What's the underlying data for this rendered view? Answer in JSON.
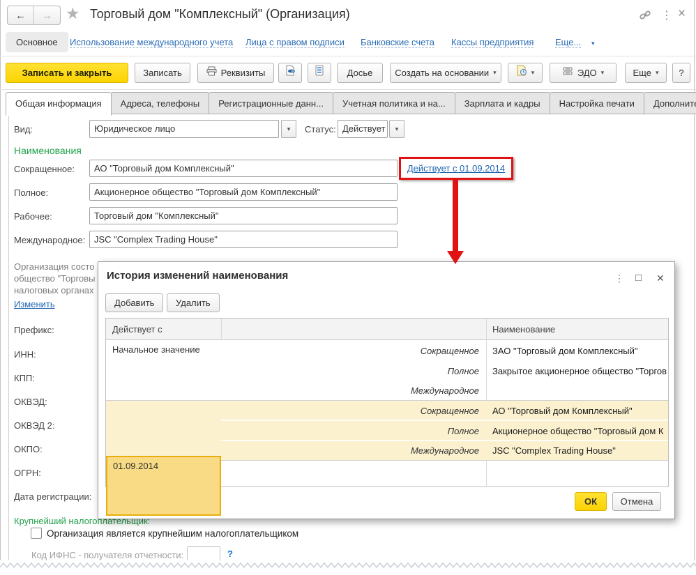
{
  "header": {
    "title": "Торговый дом \"Комплексный\" (Организация)",
    "nav": {
      "active_label": "Основное",
      "links": [
        "Использование международного учета",
        "Лица с правом подписи",
        "Банковские счета",
        "Кассы предприятия"
      ],
      "more_label": "Еще..."
    }
  },
  "icons": {
    "back": "←",
    "forward": "→",
    "star": "★",
    "dots": "⋮",
    "close": "×",
    "dropdown": "▾",
    "maximize": "□",
    "modal_close": "✕"
  },
  "toolbar": {
    "save_close": "Записать и закрыть",
    "save": "Записать",
    "requisites": "Реквизиты",
    "dossier": "Досье",
    "create_based": "Создать на основании",
    "edo": "ЭДО",
    "more": "Еще",
    "help": "?"
  },
  "tabs": [
    {
      "label": "Общая информация",
      "active": true
    },
    {
      "label": "Адреса, телефоны",
      "active": false
    },
    {
      "label": "Регистрационные данн...",
      "active": false
    },
    {
      "label": "Учетная политика и на...",
      "active": false
    },
    {
      "label": "Зарплата и кадры",
      "active": false
    },
    {
      "label": "Настройка печати",
      "active": false
    },
    {
      "label": "Дополнительно",
      "active": false
    }
  ],
  "form": {
    "vid_label": "Вид:",
    "vid_value": "Юридическое лицо",
    "status_label": "Статус:",
    "status_value": "Действует",
    "names_header": "Наименования",
    "fields": [
      {
        "label": "Сокращенное:",
        "value": "АО \"Торговый дом Комплексный\""
      },
      {
        "label": "Полное:",
        "value": "Акционерное общество \"Торговый дом Комплексный\""
      },
      {
        "label": "Рабочее:",
        "value": "Торговый дом \"Комплексный\""
      },
      {
        "label": "Международное:",
        "value": "JSC \"Complex Trading House\""
      }
    ],
    "history_link": "Действует с 01.09.2014",
    "org_note": [
      "Организация состо",
      "общество \"Торговы",
      "налоговых органах"
    ],
    "change_link": "Изменить",
    "left_labels": [
      "Префикс:",
      "ИНН:",
      "КПП:",
      "ОКВЭД:",
      "ОКВЭД 2:",
      "ОКПО:",
      "ОГРН:",
      "Дата регистрации:"
    ],
    "taxpayer_header": "Крупнейший налогоплательщик:",
    "taxpayer_checkbox_label": "Организация является крупнейшим налогоплательщиком",
    "ifns_label": "Код ИФНС - получателя отчетности:",
    "ifns_help": "?"
  },
  "modal": {
    "title": "История изменений наименования",
    "add_label": "Добавить",
    "delete_label": "Удалить",
    "ok_label": "ОК",
    "cancel_label": "Отмена",
    "table": {
      "col_date": "Действует с",
      "col_name": "Наименование",
      "groups": [
        {
          "date": "Начальное значение",
          "selected": false,
          "rows": [
            {
              "kind": "Сокращенное",
              "value": "ЗАО \"Торговый дом Комплексный\""
            },
            {
              "kind": "Полное",
              "value": "Закрытое акционерное общество \"Торгов"
            },
            {
              "kind": "Международное",
              "value": ""
            }
          ]
        },
        {
          "date": "01.09.2014",
          "selected": true,
          "rows": [
            {
              "kind": "Сокращенное",
              "value": "АО \"Торговый дом Комплексный\""
            },
            {
              "kind": "Полное",
              "value": "Акционерное общество \"Торговый дом К"
            },
            {
              "kind": "Международное",
              "value": "JSC \"Complex Trading House\""
            }
          ]
        }
      ]
    }
  },
  "colors": {
    "accent_yellow": "#FCD402",
    "selected_cell_yellow": "#F8DB84",
    "row_highlight_yellow": "#FBF1CF",
    "section_green": "#21A049",
    "link_blue": "#2065B0",
    "annotation_red": "#E01212"
  }
}
